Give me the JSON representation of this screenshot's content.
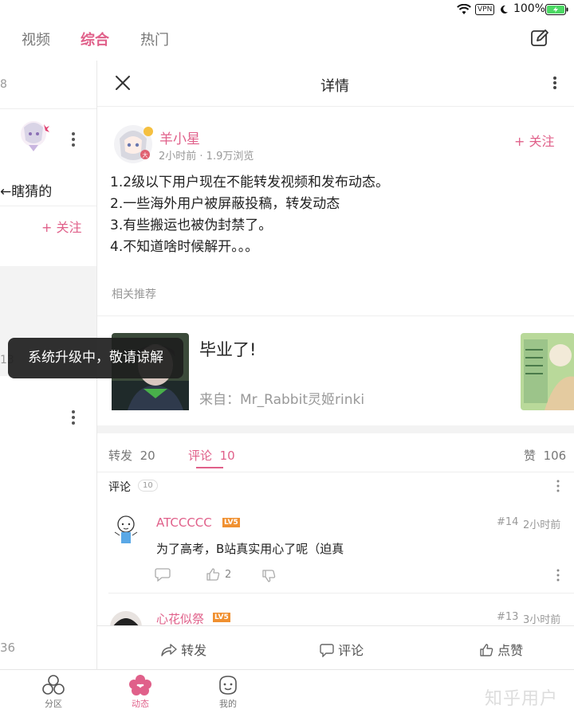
{
  "status": {
    "vpn": "VPN",
    "battery": "100%"
  },
  "top_tabs": [
    {
      "label": "视频",
      "active": false
    },
    {
      "label": "综合",
      "active": true
    },
    {
      "label": "热门",
      "active": false
    }
  ],
  "left_panel": {
    "num_top": "8",
    "text": "←瞎猜的",
    "follow": "+ 关注",
    "num_mid": "13",
    "num_bottom": "36"
  },
  "detail": {
    "title": "详情",
    "author": {
      "name": "羊小星",
      "meta": "2小时前 · 1.9万浏览",
      "follow": "+ 关注"
    },
    "content": [
      "1.2级以下用户现在不能转发视频和发布动态。",
      "2.一些海外用户被屏蔽投稿，转发动态",
      "3.有些搬运也被伪封禁了。",
      "4.不知道啥时候解开。。。"
    ],
    "related_label": "相关推荐",
    "related": {
      "title": "毕业了!",
      "source": "来自：Mr_Rabbit灵姬rinki"
    },
    "tabs": {
      "repost": "转发",
      "repost_count": "20",
      "comment": "评论",
      "comment_count": "10",
      "like": "赞",
      "like_count": "106"
    },
    "comments_header": {
      "label": "评论",
      "count": "10"
    },
    "comments": [
      {
        "name": "ATCCCCC",
        "level": "LV5",
        "floor": "#14",
        "time": "2小时前",
        "text": "为了高考，B站真实用心了呢（迫真",
        "likes": "2"
      },
      {
        "name": "心花似祭",
        "level": "LV5",
        "floor": "#13",
        "time": "3小时前"
      }
    ],
    "actions": {
      "repost": "转发",
      "comment": "评论",
      "like": "点赞"
    }
  },
  "toast": "系统升级中，敬请谅解",
  "bottom_nav": [
    {
      "label": "分区",
      "icon": "circles-icon",
      "active": false
    },
    {
      "label": "动态",
      "icon": "flower-icon",
      "active": true
    },
    {
      "label": "我的",
      "icon": "smiley-icon",
      "active": false
    }
  ],
  "watermark": "知乎用户",
  "colors": {
    "accent": "#e0608a",
    "level_badge": "#f09030"
  }
}
